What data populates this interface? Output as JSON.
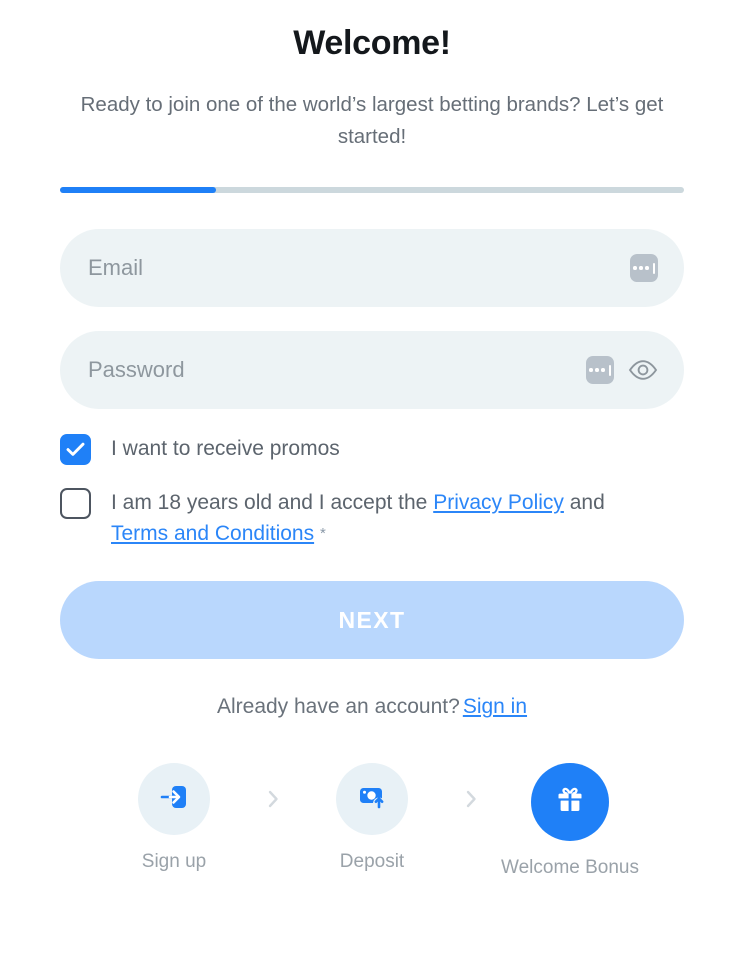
{
  "header": {
    "title": "Welcome!",
    "subtitle": "Ready to join one of the world’s largest betting brands? Let’s get started!"
  },
  "progress": {
    "percent": 25,
    "fill_color": "#1f80f7",
    "track_color": "#ccd8dd"
  },
  "form": {
    "email": {
      "placeholder": "Email",
      "value": "",
      "autofill_icon": "dots-chip-icon"
    },
    "password": {
      "placeholder": "Password",
      "value": "",
      "autofill_icon": "dots-chip-icon",
      "reveal_icon": "eye-icon"
    },
    "checkboxes": [
      {
        "checked": true,
        "label": "I want to receive promos"
      },
      {
        "checked": false,
        "label_part1": "I am 18 years old and I accept the ",
        "link1": "Privacy Policy",
        "label_part2": " and ",
        "link2": "Terms and Conditions",
        "required_mark": "*"
      }
    ],
    "submit_label": "NEXT",
    "submit_color": "#b9d7fd"
  },
  "signin": {
    "prompt": "Already have an account?",
    "link": "Sign in"
  },
  "steps": {
    "separator": "›",
    "items": [
      {
        "label": "Sign up",
        "icon": "login-arrow-icon",
        "active": false
      },
      {
        "label": "Deposit",
        "icon": "deposit-card-icon",
        "active": false
      },
      {
        "label": "Welcome Bonus",
        "icon": "gift-icon",
        "active": true
      }
    ]
  },
  "colors": {
    "accent_blue": "#1f80f7",
    "link_blue": "#2b86f8",
    "field_bg": "#edf3f5"
  }
}
